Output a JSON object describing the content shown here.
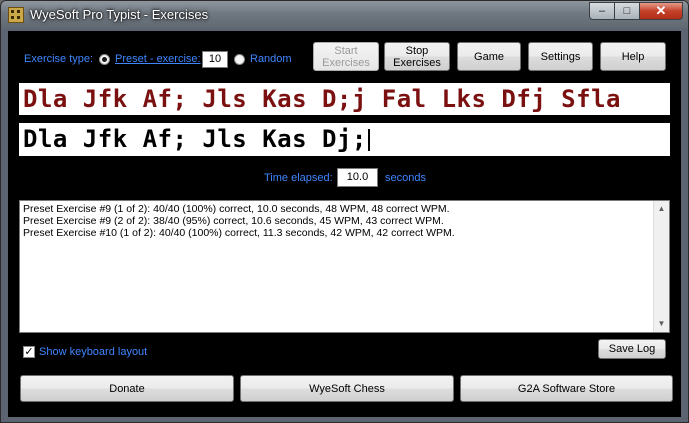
{
  "window": {
    "title": "WyeSoft Pro Typist - Exercises",
    "min_glyph": "–",
    "max_glyph": "□",
    "close_glyph": "✕"
  },
  "exercise": {
    "type_label": "Exercise type:",
    "preset_label": "Preset - exercise:",
    "preset_selected": true,
    "exercise_number": "10",
    "random_label": "Random"
  },
  "buttons": {
    "start": "Start\nExercises",
    "stop": "Stop\nExercises",
    "game": "Game",
    "settings": "Settings",
    "help": "Help"
  },
  "target_text": "Dla Jfk Af; Jls Kas D;j Fal Lks Dfj Sfla",
  "typed_text": "Dla Jfk Af; Jls Kas Dj;",
  "timer": {
    "label": "Time elapsed:",
    "value": "10.0",
    "unit": "seconds"
  },
  "log": [
    "Preset Exercise #9 (1 of 2): 40/40 (100%) correct, 10.0 seconds, 48 WPM, 48 correct WPM.",
    "Preset Exercise #9 (2 of 2): 38/40 (95%) correct, 10.6 seconds, 45 WPM, 43 correct WPM.",
    "Preset Exercise #10 (1 of 2): 40/40 (100%) correct, 11.3 seconds, 42 WPM, 42 correct WPM."
  ],
  "show_keyboard": {
    "label": "Show keyboard layout",
    "checked": true
  },
  "save_log": "Save Log",
  "footer": {
    "donate": "Donate",
    "chess": "WyeSoft Chess",
    "store": "G2A Software Store"
  },
  "colors": {
    "accent": "#3f86ff",
    "target_text": "#7a1010",
    "background": "#000000"
  }
}
